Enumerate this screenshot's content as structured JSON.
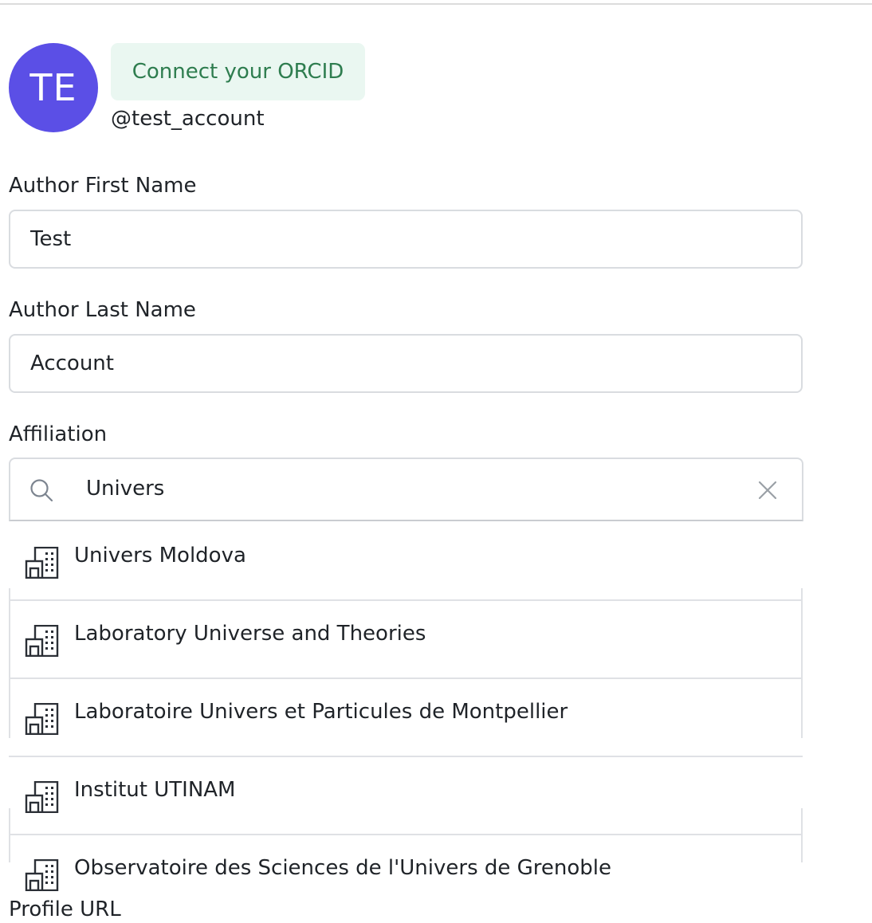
{
  "profile": {
    "avatar_initials": "TE",
    "avatar_color": "#5b4fe6",
    "orcid_button_label": "Connect your ORCID",
    "username": "@test_account"
  },
  "form": {
    "first_name": {
      "label": "Author First Name",
      "value": "Test"
    },
    "last_name": {
      "label": "Author Last Name",
      "value": "Account"
    },
    "affiliation": {
      "label": "Affiliation",
      "search_value": "Univers",
      "search_icon": "search-icon",
      "clear_icon": "close-icon",
      "option_icon": "building-icon",
      "options": [
        "Univers Moldova",
        "Laboratory Universe and Theories",
        "Laboratoire Univers et Particules de Montpellier",
        "Institut UTINAM",
        "Observatoire des Sciences de l'Univers de Grenoble"
      ]
    },
    "profile_url": {
      "label": "Profile URL"
    }
  },
  "colors": {
    "accent_green": "#2e7d4f",
    "accent_green_bg": "#eaf7f1",
    "border": "#d9dce0"
  }
}
